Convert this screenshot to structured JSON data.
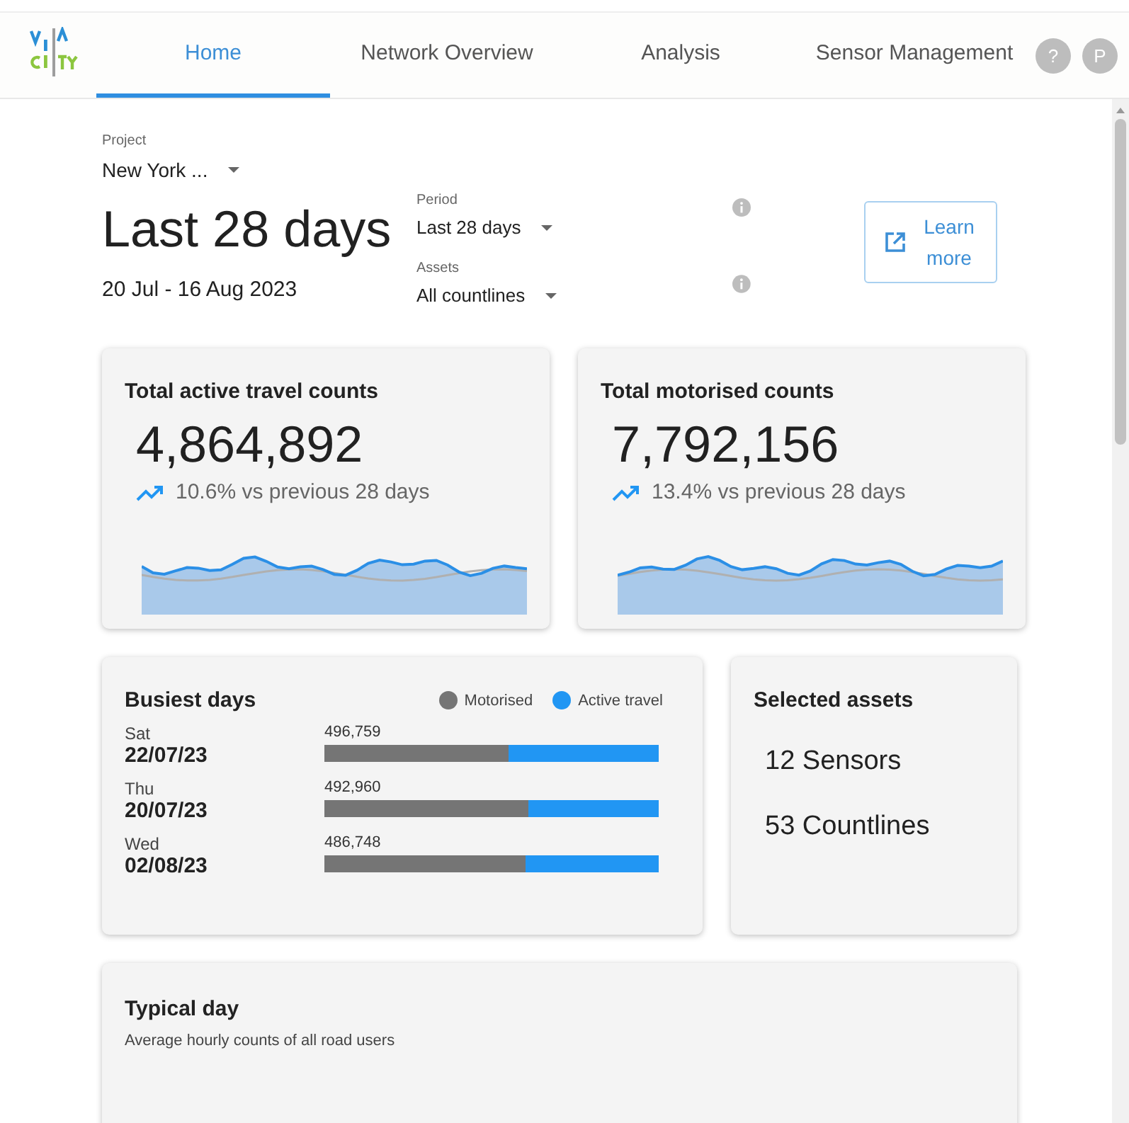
{
  "nav": {
    "tabs": [
      {
        "label": "Home",
        "selected": true
      },
      {
        "label": "Network Overview",
        "selected": false
      },
      {
        "label": "Analysis",
        "selected": false
      },
      {
        "label": "Sensor Management",
        "selected": false
      }
    ],
    "help": "?",
    "avatar": "P"
  },
  "filters": {
    "project": {
      "label": "Project",
      "value": "New York ..."
    },
    "title": "Last 28 days",
    "date_range": "20 Jul - 16 Aug 2023",
    "period": {
      "label": "Period",
      "value": "Last 28 days"
    },
    "assets": {
      "label": "Assets",
      "value": "All countlines"
    },
    "learn_more": "Learn more"
  },
  "stat_cards": [
    {
      "title": "Total active travel counts",
      "value": "4,864,892",
      "change": "10.6% vs previous 28 days"
    },
    {
      "title": "Total motorised counts",
      "value": "7,792,156",
      "change": "13.4% vs previous 28 days"
    }
  ],
  "busiest_days": {
    "title": "Busiest days",
    "legend": [
      {
        "label": "Motorised",
        "color": "#757575"
      },
      {
        "label": "Active travel",
        "color": "#2196f3"
      }
    ],
    "days": [
      {
        "weekday": "Sat",
        "date": "22/07/23",
        "total": "496,759",
        "level": 0.55
      },
      {
        "weekday": "Thu",
        "date": "20/07/23",
        "total": "492,960",
        "level": 0.61
      },
      {
        "weekday": "Wed",
        "date": "02/08/23",
        "total": "486,748",
        "level": 0.6
      }
    ]
  },
  "selected_assets": {
    "title": "Selected assets",
    "items": [
      "12 Sensors",
      "53 Countlines"
    ]
  },
  "typical_day": {
    "title": "Typical day",
    "subtitle": "Average hourly counts of all road users"
  }
}
